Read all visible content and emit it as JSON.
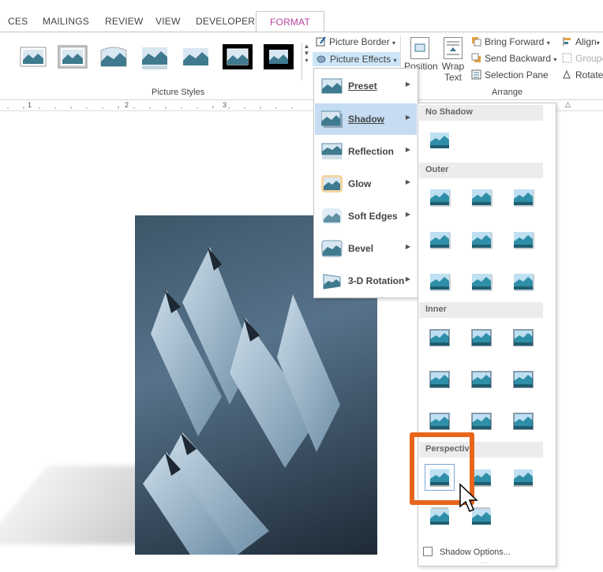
{
  "tabs": [
    "CES",
    "MAILINGS",
    "REVIEW",
    "VIEW",
    "DEVELOPER",
    "FORMAT"
  ],
  "ribbon": {
    "picture_styles_label": "Picture Styles",
    "arrange_label": "Arrange",
    "picture_border": "Picture Border",
    "picture_effects": "Picture Effects",
    "position": "Position",
    "wrap_text": "Wrap Text",
    "bring_forward": "Bring Forward",
    "send_backward": "Send Backward",
    "selection_pane": "Selection Pane",
    "align": "Align",
    "group": "Group",
    "rotate": "Rotate"
  },
  "ruler": {
    "marks": [
      "1",
      "2",
      "3"
    ]
  },
  "effects_menu": {
    "items": [
      {
        "label": "Preset",
        "icon": "preset-icon"
      },
      {
        "label": "Shadow",
        "icon": "shadow-icon",
        "selected": true
      },
      {
        "label": "Reflection",
        "icon": "reflection-icon"
      },
      {
        "label": "Glow",
        "icon": "glow-icon"
      },
      {
        "label": "Soft Edges",
        "icon": "soft-edges-icon"
      },
      {
        "label": "Bevel",
        "icon": "bevel-icon"
      },
      {
        "label": "3-D Rotation",
        "icon": "3d-rotation-icon"
      }
    ]
  },
  "shadow_gallery": {
    "sections": [
      "No Shadow",
      "Outer",
      "Inner",
      "Perspective"
    ],
    "shadow_options": "Shadow Options..."
  },
  "colors": {
    "accent": "#b4429a",
    "highlight": "#e8661b",
    "selected": "#c5dcf2"
  }
}
